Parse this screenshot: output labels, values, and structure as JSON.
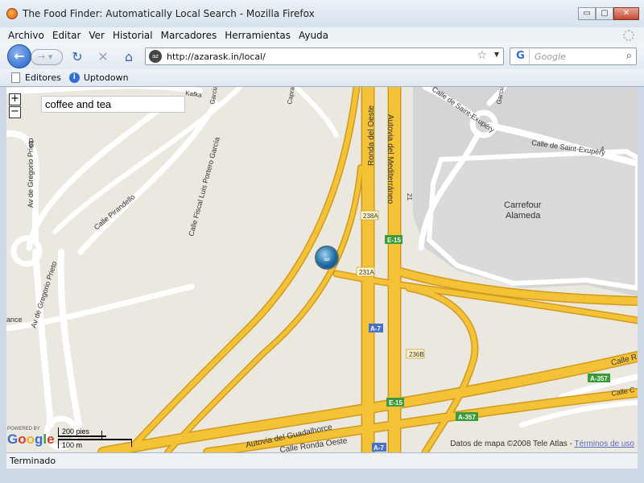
{
  "window": {
    "title": "The Food Finder: Automatically Local Search - Mozilla Firefox",
    "minimize_glyph": "▭",
    "maximize_glyph": "▢",
    "close_glyph": "✕"
  },
  "menu": {
    "items": [
      "Archivo",
      "Editar",
      "Ver",
      "Historial",
      "Marcadores",
      "Herramientas",
      "Ayuda"
    ]
  },
  "navigation": {
    "back_glyph": "←",
    "forward_glyph": "→ ▾",
    "reload_glyph": "↻",
    "stop_glyph": "✕",
    "home_glyph": "⌂",
    "url": "http://azarask.in/local/",
    "site_icon_text": "az",
    "star_glyph": "☆",
    "dropdown_glyph": "▼"
  },
  "search": {
    "engine_glyph": "G",
    "placeholder": "Google",
    "magnifier_glyph": "⌕"
  },
  "bookmarks": {
    "items": [
      {
        "label": "Editores"
      },
      {
        "label": "Uptodown"
      }
    ]
  },
  "map": {
    "zoom_in_label": "+",
    "zoom_out_label": "−",
    "query": "coffee and tea",
    "marker_glyph": "☕",
    "labels": {
      "ronda_oeste": "Ronda del Oeste",
      "autovia_med": "Autovia del Mediterráneo",
      "carrefour_1": "Carrefour",
      "carrefour_2": "Alameda",
      "saint_exupery": "Calle de Saint-Exupéry",
      "saint_exupery_top": "Calle de Saint-Exupéry",
      "pirandello": "Calle Pirandello",
      "fiscal": "Calle Fiscal Luis Portero García",
      "gregorio_1": "Av de Gregorio Prieto",
      "gregorio_2": "Av de Gregorio Prieto",
      "guadalhorce": "Autovia del Guadalhorce",
      "calle_ronda_oeste": "Calle Ronda Oeste",
      "calle_r": "Calle R",
      "calle_c": "Calle C",
      "kafka": "Kafka",
      "capra": "Capra",
      "garcia_top": "Garcia",
      "ance": "ance",
      "num_21": "21",
      "num_4": "4",
      "num_19": "19",
      "exit_238a": "238A",
      "exit_231a": "231A",
      "exit_236b": "236B"
    },
    "shields": {
      "e15_a": "E-15",
      "e15_b": "E-15",
      "a7_a": "A-7",
      "a7_b": "A-7",
      "a357_a": "A-357",
      "a357_b": "A-357"
    },
    "logo_powered": "POWERED BY",
    "logo_text": "Google",
    "scale_feet": "200 pies",
    "scale_meters": "100 m",
    "attribution": "Datos de mapa ©2008 Tele Atlas - ",
    "terms": "Términos de uso"
  },
  "status": {
    "text": "Terminado"
  },
  "colors": {
    "highway": "#f4c236",
    "highway_border": "#d19a1d",
    "street": "#ffffff",
    "land": "#ebe8df",
    "parking": "#d5d5d5",
    "shield_green": "#3b9a3b",
    "shield_blue": "#4a72c4"
  }
}
